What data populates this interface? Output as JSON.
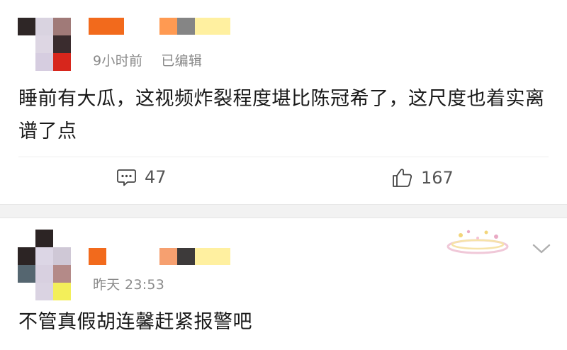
{
  "comments": [
    {
      "time": "9小时前",
      "edited": "已编辑",
      "text": "睡前有大瓜，这视频炸裂程度堪比陈冠希了，这尺度也着实离谱了点",
      "reply_count": "47",
      "like_count": "167",
      "avatar_colors": [
        "#2e2626",
        "#d9d3e0",
        "#a07a78",
        "#ffffff",
        "#ddd6e3",
        "#3a2c2e",
        "#ffffff",
        "#d6cde0",
        "#d7261c"
      ],
      "name_colors": [
        "#f26a1c",
        "#ffffff",
        "#ff9a52",
        "#858585",
        "#fff0a0"
      ]
    },
    {
      "time": "昨天 23:53",
      "text": "不管真假胡连馨赶紧报警吧",
      "avatar_colors": [
        "#ffffff",
        "#2c2424",
        "#ffffff",
        "#2c2424",
        "#dcd6e5",
        "#cfc8d6",
        "#556670",
        "#d8d0e0",
        "#b48a88",
        "#ffffff",
        "#dad3e2",
        "#f3ef5a"
      ],
      "name_colors": [
        "#f26a1c",
        "#ffffff",
        "#ffffff",
        "#f6a070",
        "#3d3a3a",
        "#fff0a0"
      ]
    }
  ],
  "icons": {
    "comment": "comment-bubble-icon",
    "like": "thumbs-up-icon",
    "expand": "chevron-down-icon",
    "badge": "decorative-badge-icon"
  }
}
